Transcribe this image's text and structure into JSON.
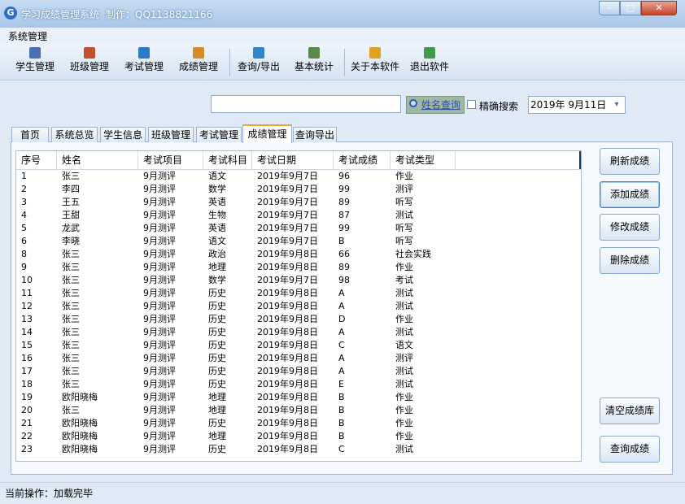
{
  "window": {
    "app_name": "学习成绩管理系统",
    "author": "制作：QQ1138821166",
    "min_symbol": "–",
    "max_symbol": "□",
    "close_symbol": "✕"
  },
  "menu": {
    "system": "系统管理"
  },
  "toolbar": [
    {
      "label": "学生管理",
      "icon": "student-icon",
      "color": "#4a6fb3"
    },
    {
      "label": "班级管理",
      "icon": "class-icon",
      "color": "#c0522f"
    },
    {
      "label": "考试管理",
      "icon": "exam-icon",
      "color": "#2f79c9"
    },
    {
      "label": "成绩管理",
      "icon": "score-icon",
      "color": "#d48a2a"
    },
    {
      "label": "查询/导出",
      "icon": "export-icon",
      "color": "#2f86c9"
    },
    {
      "label": "基本统计",
      "icon": "stats-icon",
      "color": "#5a8a4a"
    },
    {
      "label": "关于本软件",
      "icon": "about-icon",
      "color": "#e0a020"
    },
    {
      "label": "退出软件",
      "icon": "exit-icon",
      "color": "#3f9a4a"
    }
  ],
  "search": {
    "value": "",
    "button": "姓名查询",
    "exact_label": "精确搜索",
    "date": "2019年  9月11日",
    "date_drop": "▾"
  },
  "tabs": [
    "首页",
    "系统总览",
    "学生信息",
    "班级管理",
    "考试管理",
    "成绩管理",
    "查询导出"
  ],
  "table": {
    "columns": [
      "序号",
      "姓名",
      "考试项目",
      "考试科目",
      "考试日期",
      "考试成绩",
      "考试类型"
    ],
    "rows": [
      [
        "1",
        "张三",
        "9月测评",
        "语文",
        "2019年9月7日",
        "96",
        "作业"
      ],
      [
        "2",
        "李四",
        "9月测评",
        "数学",
        "2019年9月7日",
        "99",
        "测评"
      ],
      [
        "3",
        "王五",
        "9月测评",
        "英语",
        "2019年9月7日",
        "89",
        "听写"
      ],
      [
        "4",
        "王甜",
        "9月测评",
        "生物",
        "2019年9月7日",
        "87",
        "测试"
      ],
      [
        "5",
        "龙武",
        "9月测评",
        "英语",
        "2019年9月7日",
        "99",
        "听写"
      ],
      [
        "6",
        "李晓",
        "9月测评",
        "语文",
        "2019年9月7日",
        "B",
        "听写"
      ],
      [
        "8",
        "张三",
        "9月测评",
        "政治",
        "2019年9月8日",
        "66",
        "社会实践"
      ],
      [
        "9",
        "张三",
        "9月测评",
        "地理",
        "2019年9月8日",
        "89",
        "作业"
      ],
      [
        "10",
        "张三",
        "9月测评",
        "数学",
        "2019年9月7日",
        "98",
        "考试"
      ],
      [
        "11",
        "张三",
        "9月测评",
        "历史",
        "2019年9月8日",
        "A",
        "测试"
      ],
      [
        "12",
        "张三",
        "9月测评",
        "历史",
        "2019年9月8日",
        "A",
        "测试"
      ],
      [
        "13",
        "张三",
        "9月测评",
        "历史",
        "2019年9月8日",
        "D",
        "作业"
      ],
      [
        "14",
        "张三",
        "9月测评",
        "历史",
        "2019年9月8日",
        "A",
        "测试"
      ],
      [
        "15",
        "张三",
        "9月测评",
        "历史",
        "2019年9月8日",
        "C",
        "语文"
      ],
      [
        "16",
        "张三",
        "9月测评",
        "历史",
        "2019年9月8日",
        "A",
        "测评"
      ],
      [
        "17",
        "张三",
        "9月测评",
        "历史",
        "2019年9月8日",
        "A",
        "测试"
      ],
      [
        "18",
        "张三",
        "9月测评",
        "历史",
        "2019年9月8日",
        "E",
        "测试"
      ],
      [
        "19",
        "欧阳晓梅",
        "9月测评",
        "地理",
        "2019年9月8日",
        "B",
        "作业"
      ],
      [
        "20",
        "张三",
        "9月测评",
        "地理",
        "2019年9月8日",
        "B",
        "作业"
      ],
      [
        "21",
        "欧阳晓梅",
        "9月测评",
        "历史",
        "2019年9月8日",
        "B",
        "作业"
      ],
      [
        "22",
        "欧阳晓梅",
        "9月测评",
        "地理",
        "2019年9月8日",
        "B",
        "作业"
      ],
      [
        "23",
        "欧阳晓梅",
        "9月测评",
        "历史",
        "2019年9月8日",
        "C",
        "测试"
      ]
    ]
  },
  "actions": {
    "refresh": "刷新成绩",
    "add": "添加成绩",
    "edit": "修改成绩",
    "delete": "删除成绩",
    "clear": "清空成绩库",
    "query": "查询成绩"
  },
  "status": "当前操作：加载完毕"
}
